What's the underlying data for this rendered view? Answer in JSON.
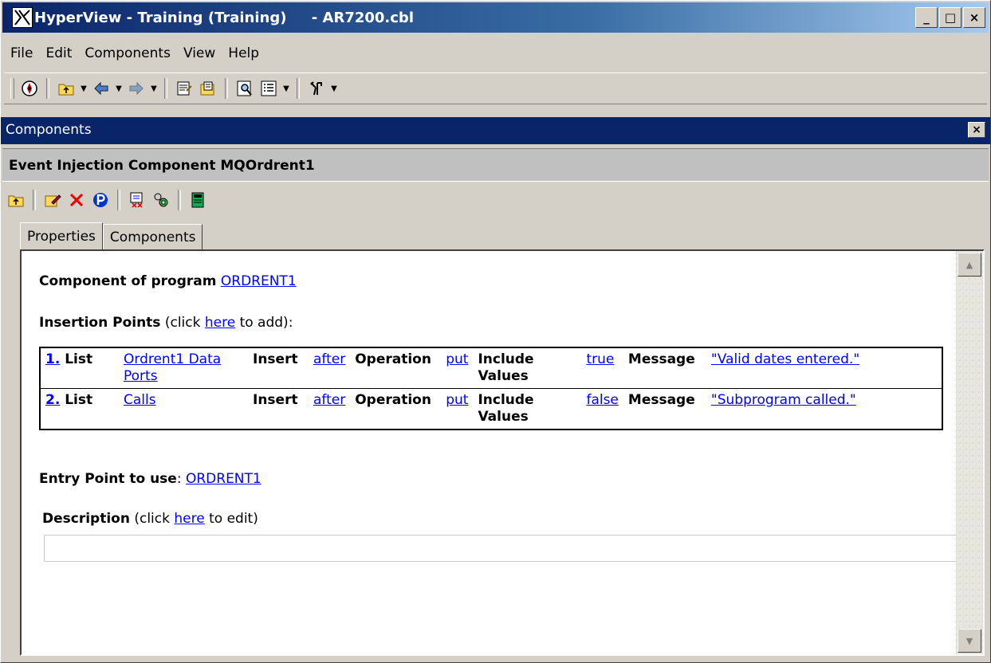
{
  "window": {
    "title": "HyperView - Training (Training)     - AR7200.cbl",
    "minimize": "_",
    "maximize": "□",
    "close": "×"
  },
  "menu": [
    {
      "label": "File"
    },
    {
      "label": "Edit"
    },
    {
      "label": "Components"
    },
    {
      "label": "View"
    },
    {
      "label": "Help"
    }
  ],
  "panel": {
    "title": "Components",
    "close": "×",
    "component_title": "Event Injection Component MQOrdrent1"
  },
  "tabs": [
    {
      "label": "Properties",
      "active": true
    },
    {
      "label": "Components",
      "active": false
    }
  ],
  "content": {
    "component_of_label": "Component of program",
    "component_of_value": "ORDRENT1",
    "insertion_label": "Insertion Points",
    "insertion_pre": " (click ",
    "insertion_link": "here",
    "insertion_post": " to add):",
    "rows": [
      {
        "num": "1.",
        "list_label": "List",
        "list_value": "Ordrent1 Data Ports",
        "insert_label": "Insert",
        "insert_value": "after",
        "op_label": "Operation",
        "op_value": "put",
        "include_label": "Include Values",
        "include_value": "true",
        "msg_label": "Message",
        "msg_value": "\"Valid dates entered.\""
      },
      {
        "num": "2.",
        "list_label": "List",
        "list_value": "Calls",
        "insert_label": "Insert",
        "insert_value": "after",
        "op_label": "Operation",
        "op_value": "put",
        "include_label": "Include Values",
        "include_value": "false",
        "msg_label": "Message",
        "msg_value": "\"Subprogram called.\""
      }
    ],
    "entry_label": "Entry Point to use",
    "entry_colon": ": ",
    "entry_value": "ORDRENT1",
    "description_label": "Description",
    "description_pre": " (click ",
    "description_link": "here",
    "description_post": " to edit)",
    "description_value": ""
  },
  "colors": {
    "titlebar_start": "#0a246a",
    "titlebar_end": "#a6caf0",
    "link": "#0000ff",
    "face": "#d4d0c8"
  }
}
